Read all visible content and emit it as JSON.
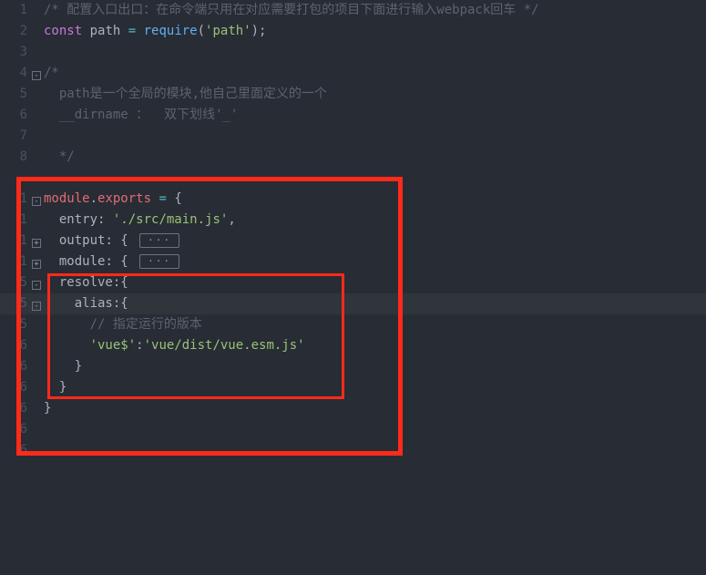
{
  "lines": {
    "l1_num": "1",
    "l1_comment": "/* 配置入口出口：在命令端只用在对应需要打包的项目下面进行输入webpack回车 */",
    "l2_num": "2",
    "l2_kw": "const",
    "l2_var": " path ",
    "l2_eq": "=",
    "l2_fn": " require",
    "l2_p1": "(",
    "l2_str": "'path'",
    "l2_p2": ");",
    "l3_num": "3",
    "l4_num": "4",
    "l4_c": "/* ",
    "l5_num": "5",
    "l5_c": "  path是一个全局的模块,他自己里面定义的一个",
    "l6_num": "6",
    "l6_c": "  __dirname ：  双下划线'_'",
    "l7_num": "7",
    "l8_num": "8",
    "l8_c": "  */",
    "l9_num": "",
    "l10_num": "1",
    "l10_a": "module",
    "l10_b": ".",
    "l10_c": "exports ",
    "l10_d": "=",
    "l10_e": " {",
    "l11_num": "1",
    "l11_a": "  entry",
    "l11_b": ": ",
    "l11_c": "'./src/main.js'",
    "l11_d": ",",
    "l12_num": "1",
    "l12_a": "  output",
    "l12_b": ": { ",
    "l12_fold": "···",
    "l13_num": "1",
    "l13_a": "  module",
    "l13_b": ": { ",
    "l13_fold": "···",
    "l14_num": "5",
    "l14_a": "  resolve",
    "l14_b": ":{",
    "l15_num": "5",
    "l15_a": "    alias",
    "l15_b": ":{",
    "l16_num": "5",
    "l16_a": "      // 指定运行的版本",
    "l17_num": "6",
    "l17_a": "      'vue$'",
    "l17_b": ":",
    "l17_c": "'vue/dist/vue.esm.js'",
    "l18_num": "6",
    "l18_a": "    }",
    "l19_num": "6",
    "l19_a": "  }",
    "l20_num": "6",
    "l20_a": "}",
    "l21_num": "6",
    "l22_num": "6"
  },
  "fold": {
    "minus": "-",
    "plus": "+"
  }
}
